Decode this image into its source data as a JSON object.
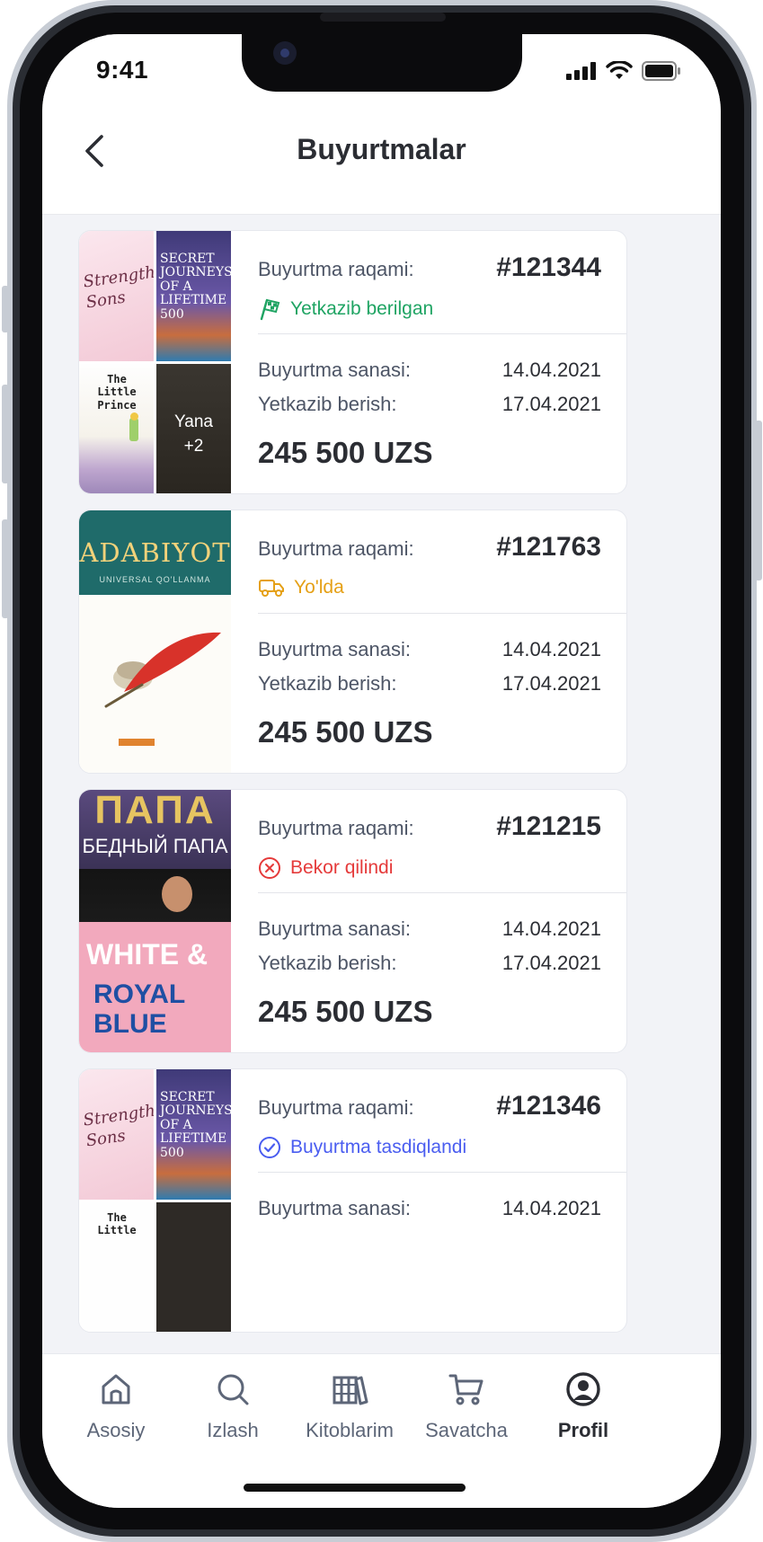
{
  "status_bar": {
    "time": "9:41"
  },
  "header": {
    "title": "Buyurtmalar"
  },
  "orders": [
    {
      "number_label": "Buyurtma raqami:",
      "number": "#121344",
      "status": "Yetkazib berilgan",
      "status_color": "#1fa463",
      "status_icon": "flag-icon",
      "order_date_label": "Buyurtma sanasi:",
      "order_date": "14.04.2021",
      "delivery_label": "Yetkazib berish:",
      "delivery_date": "17.04.2021",
      "total": "245 500 UZS",
      "covers": [
        {
          "title": "Strength Sons"
        },
        {
          "title": "SECRET JOURNEYS OF A LIFETIME 500"
        },
        {
          "title": "The Little Prince"
        },
        {
          "title": "Yana",
          "more": "+2"
        }
      ]
    },
    {
      "number_label": "Buyurtma raqami:",
      "number": "#121763",
      "status": "Yo'lda",
      "status_color": "#e5a016",
      "status_icon": "truck-icon",
      "order_date_label": "Buyurtma sanasi:",
      "order_date": "14.04.2021",
      "delivery_label": "Yetkazib berish:",
      "delivery_date": "17.04.2021",
      "total": "245 500 UZS",
      "covers": [
        {
          "title": "ADABIYOT",
          "subtitle": "UNIVERSAL QO'LLANMA"
        }
      ]
    },
    {
      "number_label": "Buyurtma raqami:",
      "number": "#121215",
      "status": "Bekor qilindi",
      "status_color": "#e53a3a",
      "status_icon": "cancel-circle-icon",
      "order_date_label": "Buyurtma sanasi:",
      "order_date": "14.04.2021",
      "delivery_label": "Yetkazib berish:",
      "delivery_date": "17.04.2021",
      "total": "245 500 UZS",
      "covers": [
        {
          "title": "ПАПА",
          "subtitle": "БЕДНЫЙ ПАПА"
        },
        {
          "title": "WHITE &",
          "subtitle": "ROYAL BLUE"
        }
      ]
    },
    {
      "number_label": "Buyurtma raqami:",
      "number": "#121346",
      "status": "Buyurtma tasdiqlandi",
      "status_color": "#4a5df0",
      "status_icon": "check-circle-icon",
      "order_date_label": "Buyurtma sanasi:",
      "order_date": "14.04.2021",
      "covers": [
        {
          "title": "Strength Sons"
        },
        {
          "title": "SECRET JOURNEYS OF A LIFETIME 500"
        },
        {
          "title": "The Little"
        }
      ]
    }
  ],
  "bottom_nav": [
    {
      "label": "Asosiy",
      "icon": "home-icon"
    },
    {
      "label": "Izlash",
      "icon": "search-icon"
    },
    {
      "label": "Kitoblarim",
      "icon": "books-icon"
    },
    {
      "label": "Savatcha",
      "icon": "cart-icon"
    },
    {
      "label": "Profil",
      "icon": "profile-icon",
      "active": true
    }
  ]
}
